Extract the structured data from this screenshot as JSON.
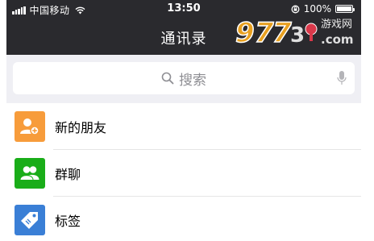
{
  "status_bar": {
    "carrier": "中国移动",
    "time": "13:50",
    "battery_percent": "100%",
    "battery_level": 1.0
  },
  "nav": {
    "title": "通讯录"
  },
  "watermark": {
    "text": "9773 游戏网 .com"
  },
  "search": {
    "placeholder": "搜索"
  },
  "list": {
    "items": [
      {
        "label": "新的朋友",
        "icon": "add-friend-icon",
        "color": "#f79c3b"
      },
      {
        "label": "群聊",
        "icon": "group-chat-icon",
        "color": "#1aad19"
      },
      {
        "label": "标签",
        "icon": "tag-icon",
        "color": "#3a7fd6"
      }
    ]
  },
  "colors": {
    "header_bg": "#2a2a2e",
    "page_bg": "#efeff4"
  }
}
